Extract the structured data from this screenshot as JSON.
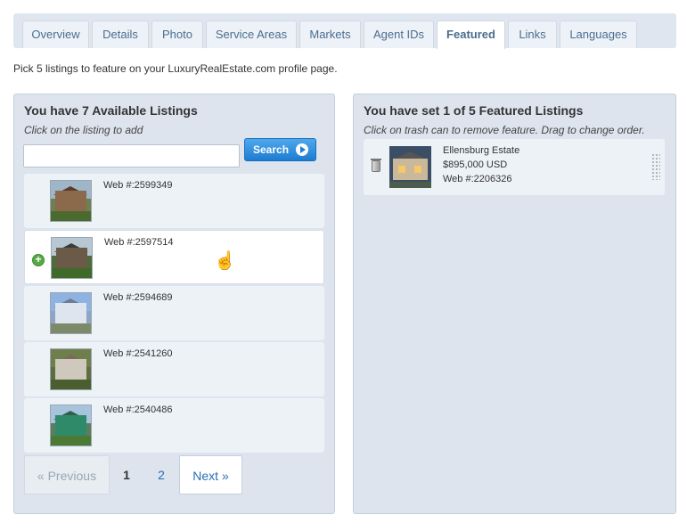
{
  "tabs": [
    {
      "label": "Overview",
      "active": false
    },
    {
      "label": "Details",
      "active": false
    },
    {
      "label": "Photo",
      "active": false
    },
    {
      "label": "Service Areas",
      "active": false
    },
    {
      "label": "Markets",
      "active": false
    },
    {
      "label": "Agent IDs",
      "active": false
    },
    {
      "label": "Featured",
      "active": true
    },
    {
      "label": "Links",
      "active": false
    },
    {
      "label": "Languages",
      "active": false
    }
  ],
  "intro": "Pick 5 listings to feature on your LuxuryRealEstate.com profile page.",
  "available": {
    "title": "You have 7 Available Listings",
    "subtitle": "Click on the listing to add",
    "search": {
      "value": "",
      "button_label": "Search"
    },
    "listings": [
      {
        "web": "Web #:2599349",
        "hover": false
      },
      {
        "web": "Web #:2597514",
        "hover": true
      },
      {
        "web": "Web #:2594689",
        "hover": false
      },
      {
        "web": "Web #:2541260",
        "hover": false
      },
      {
        "web": "Web #:2540486",
        "hover": false
      }
    ],
    "pager": {
      "prev": "« Previous",
      "page1": "1",
      "page2": "2",
      "next": "Next »"
    }
  },
  "featured": {
    "title": "You have set 1 of 5 Featured Listings",
    "subtitle": "Click on trash can to remove feature. Drag to change order.",
    "items": [
      {
        "name": "Ellensburg Estate",
        "price": "$895,000 USD",
        "web": "Web #:2206326"
      }
    ]
  },
  "icons": {
    "add": "plus-circle-icon",
    "trash": "trash-icon",
    "drag": "drag-handle-icon",
    "search_button": "play-circle-icon",
    "cursor": "hand-pointer-icon"
  },
  "colors": {
    "tab_text": "#4a6d8e",
    "panel_bg": "#dde4ee",
    "search_button": "#1e7cd1",
    "link": "#2a6db3"
  }
}
